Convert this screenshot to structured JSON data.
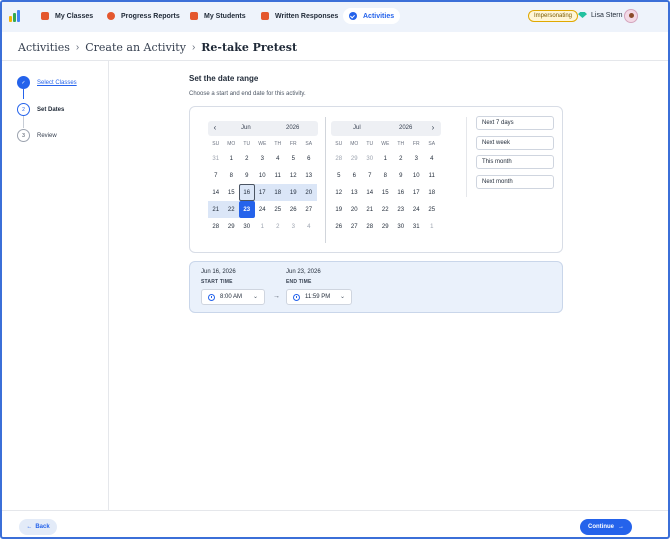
{
  "nav": {
    "items": [
      {
        "label": "My Classes",
        "color": "#e4572e"
      },
      {
        "label": "Progress Reports",
        "color": "#e4572e"
      },
      {
        "label": "My Students",
        "color": "#e4572e"
      },
      {
        "label": "Written Responses",
        "color": "#e4572e"
      },
      {
        "label": "Activities",
        "color": "#2563eb",
        "active": true
      }
    ],
    "impersonating_label": "Impersonating",
    "user_name": "Lisa Stern"
  },
  "breadcrumb": {
    "items": [
      "Activities",
      "Create an Activity",
      "Re-take Pretest"
    ]
  },
  "stepper": {
    "steps": [
      {
        "number": "✓",
        "label": "Select Classes",
        "state": "done"
      },
      {
        "number": "2",
        "label": "Set Dates",
        "state": "current"
      },
      {
        "number": "3",
        "label": "Review",
        "state": "pending"
      }
    ]
  },
  "main": {
    "title": "Set the date range",
    "subtitle": "Choose a start and end date for this activity."
  },
  "calendars": {
    "weekdays": [
      "SU",
      "MO",
      "TU",
      "WE",
      "TH",
      "FR",
      "SA"
    ],
    "left": {
      "month": "Jun",
      "year": "2026",
      "days": [
        [
          "31",
          "out"
        ],
        [
          "1",
          ""
        ],
        [
          "2",
          ""
        ],
        [
          "3",
          ""
        ],
        [
          "4",
          ""
        ],
        [
          "5",
          ""
        ],
        [
          "6",
          ""
        ],
        [
          "7",
          ""
        ],
        [
          "8",
          ""
        ],
        [
          "9",
          ""
        ],
        [
          "10",
          ""
        ],
        [
          "11",
          ""
        ],
        [
          "12",
          ""
        ],
        [
          "13",
          ""
        ],
        [
          "14",
          ""
        ],
        [
          "15",
          ""
        ],
        [
          "16",
          "start"
        ],
        [
          "17",
          "rng"
        ],
        [
          "18",
          "rng"
        ],
        [
          "19",
          "rng"
        ],
        [
          "20",
          "rng"
        ],
        [
          "21",
          "rng"
        ],
        [
          "22",
          "rng"
        ],
        [
          "23",
          "end"
        ],
        [
          "24",
          ""
        ],
        [
          "25",
          ""
        ],
        [
          "26",
          ""
        ],
        [
          "27",
          ""
        ],
        [
          "28",
          ""
        ],
        [
          "29",
          ""
        ],
        [
          "30",
          ""
        ],
        [
          "1",
          "out"
        ],
        [
          "2",
          "out"
        ],
        [
          "3",
          "out"
        ],
        [
          "4",
          "out"
        ]
      ]
    },
    "right": {
      "month": "Jul",
      "year": "2026",
      "days": [
        [
          "28",
          "out"
        ],
        [
          "29",
          "out"
        ],
        [
          "30",
          "out"
        ],
        [
          "1",
          ""
        ],
        [
          "2",
          ""
        ],
        [
          "3",
          ""
        ],
        [
          "4",
          ""
        ],
        [
          "5",
          ""
        ],
        [
          "6",
          ""
        ],
        [
          "7",
          ""
        ],
        [
          "8",
          ""
        ],
        [
          "9",
          ""
        ],
        [
          "10",
          ""
        ],
        [
          "11",
          ""
        ],
        [
          "12",
          ""
        ],
        [
          "13",
          ""
        ],
        [
          "14",
          ""
        ],
        [
          "15",
          ""
        ],
        [
          "16",
          ""
        ],
        [
          "17",
          ""
        ],
        [
          "18",
          ""
        ],
        [
          "19",
          ""
        ],
        [
          "20",
          ""
        ],
        [
          "21",
          ""
        ],
        [
          "22",
          ""
        ],
        [
          "23",
          ""
        ],
        [
          "24",
          ""
        ],
        [
          "25",
          ""
        ],
        [
          "26",
          ""
        ],
        [
          "27",
          ""
        ],
        [
          "28",
          ""
        ],
        [
          "29",
          ""
        ],
        [
          "30",
          ""
        ],
        [
          "31",
          ""
        ],
        [
          "1",
          "out"
        ]
      ]
    }
  },
  "quick_ranges": [
    "Next 7 days",
    "Next week",
    "This month",
    "Next month"
  ],
  "time": {
    "start_date": "Jun 16, 2026",
    "start_label": "START TIME",
    "start_value": "8:00 AM",
    "end_date": "Jun 23, 2026",
    "end_label": "END TIME",
    "end_value": "11:59 PM"
  },
  "footer": {
    "back_label": "Back",
    "continue_label": "Continue"
  },
  "colors": {
    "accent": "#2563eb",
    "range_fill": "#dbe6f7",
    "nav_bg": "#eef3fb"
  }
}
